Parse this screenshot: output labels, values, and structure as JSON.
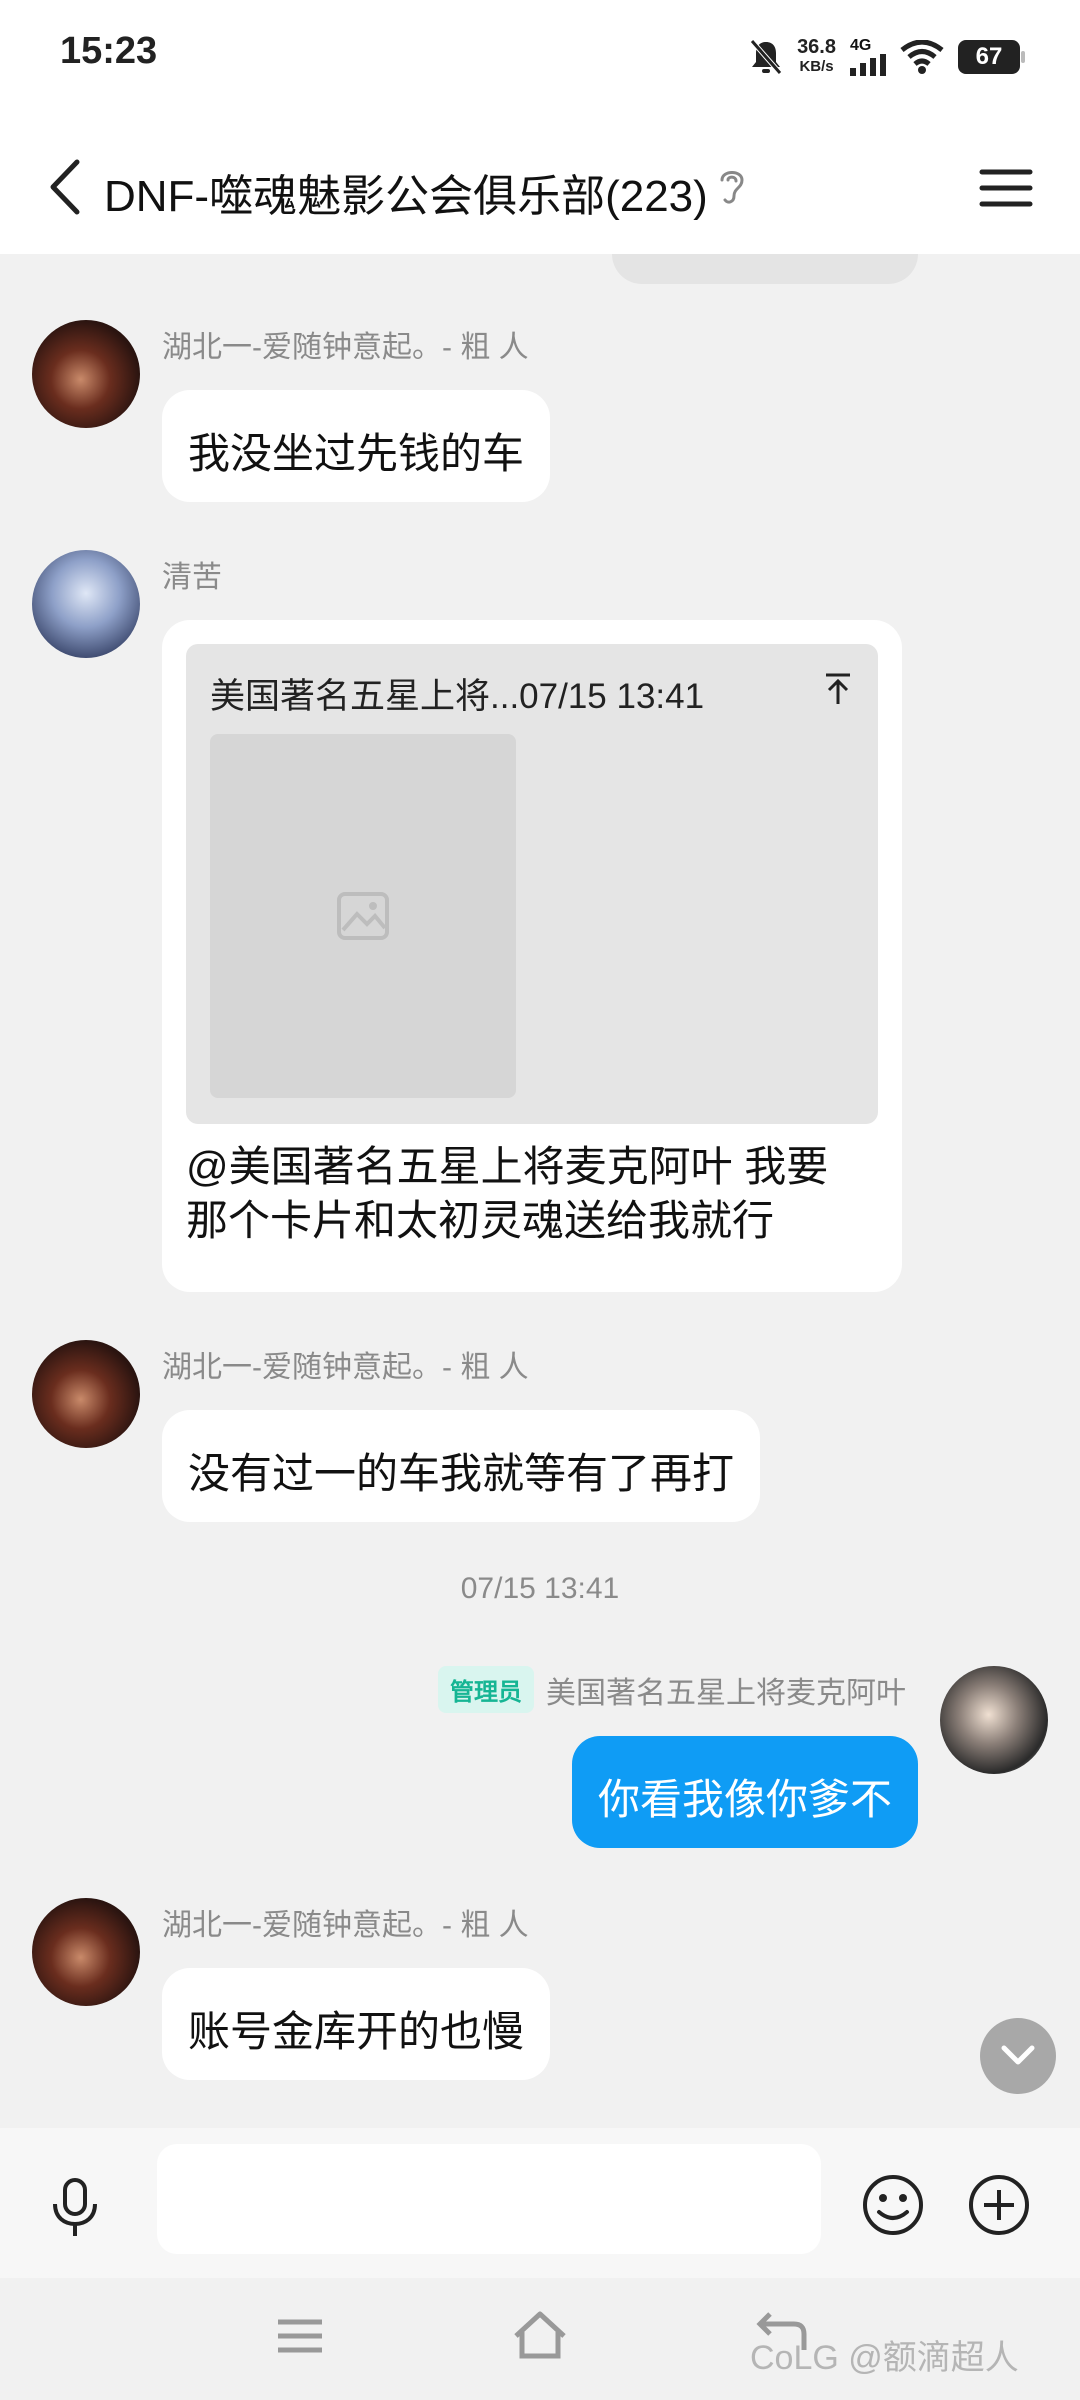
{
  "status_bar": {
    "time": "15:23",
    "net_speed_value": "36.8",
    "net_speed_unit": "KB/s",
    "network": "4G",
    "battery": "67"
  },
  "header": {
    "title": "DNF-噬魂魅影公会俱乐部(223)"
  },
  "messages": [
    {
      "sender": "湖北一-爱随钟意起。- 粗 人",
      "text": "我没坐过先钱的车"
    },
    {
      "sender": "清苦",
      "quote_head": "美国著名五星上将...07/15 13:41",
      "text": "@美国著名五星上将麦克阿叶 我要\n那个卡片和太初灵魂送给我就行"
    },
    {
      "sender": "湖北一-爱随钟意起。- 粗 人",
      "text": "没有过一的车我就等有了再打"
    },
    {
      "timestamp": "07/15 13:41"
    },
    {
      "badge": "管理员",
      "sender": "美国著名五星上将麦克阿叶",
      "text": "你看我像你爹不"
    },
    {
      "sender": "湖北一-爱随钟意起。- 粗 人",
      "text": "账号金库开的也慢"
    }
  ],
  "input": {
    "placeholder": ""
  },
  "watermark": "CoLG @额滴超人",
  "colors": {
    "self_bubble": "#0f9cf5",
    "admin_badge_text": "#16b594",
    "background": "#f1f1f1"
  }
}
